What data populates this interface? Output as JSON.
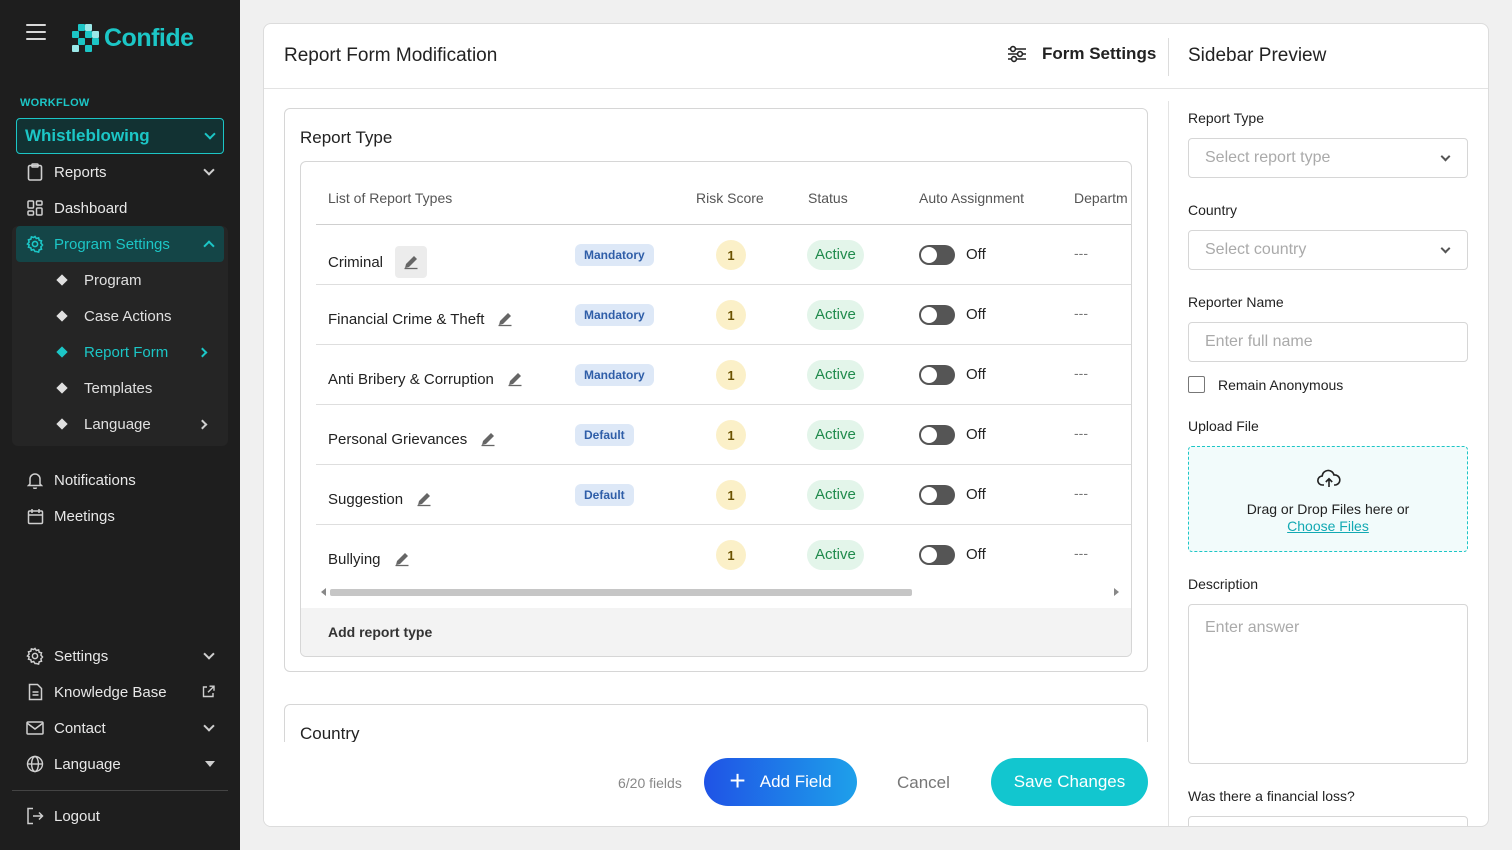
{
  "brand": {
    "name": "Confide",
    "color": "#1cc6c6"
  },
  "sidebar": {
    "section_label": "WORKFLOW",
    "workflow_select": "Whistleblowing",
    "items": [
      {
        "label": "Reports",
        "icon": "clipboard-icon"
      },
      {
        "label": "Dashboard",
        "icon": "dashboard-icon"
      },
      {
        "label": "Program Settings",
        "icon": "gear-icon"
      }
    ],
    "sub_items": [
      {
        "label": "Program"
      },
      {
        "label": "Case Actions"
      },
      {
        "label": "Report Form"
      },
      {
        "label": "Templates"
      },
      {
        "label": "Language"
      }
    ],
    "lower_items": [
      {
        "label": "Notifications",
        "icon": "bell-icon"
      },
      {
        "label": "Meetings",
        "icon": "calendar-icon"
      }
    ],
    "bottom_items": [
      {
        "label": "Settings",
        "icon": "gear-icon"
      },
      {
        "label": "Knowledge Base",
        "icon": "document-icon"
      },
      {
        "label": "Contact",
        "icon": "mail-icon"
      },
      {
        "label": "Language",
        "icon": "globe-icon"
      }
    ],
    "logout": "Logout"
  },
  "main": {
    "title": "Report Form Modification",
    "form_settings": "Form Settings",
    "report_type_section": {
      "title": "Report Type",
      "columns": [
        "List of Report Types",
        "Risk Score",
        "Status",
        "Auto Assignment",
        "Departm"
      ],
      "rows": [
        {
          "name": "Criminal",
          "badge": "Mandatory",
          "risk": "1",
          "status": "Active",
          "auto": "Off",
          "dept": "---"
        },
        {
          "name": "Financial Crime & Theft",
          "badge": "Mandatory",
          "risk": "1",
          "status": "Active",
          "auto": "Off",
          "dept": "---"
        },
        {
          "name": "Anti Bribery & Corruption",
          "badge": "Mandatory",
          "risk": "1",
          "status": "Active",
          "auto": "Off",
          "dept": "---"
        },
        {
          "name": "Personal Grievances",
          "badge": "Default",
          "risk": "1",
          "status": "Active",
          "auto": "Off",
          "dept": "---"
        },
        {
          "name": "Suggestion",
          "badge": "Default",
          "risk": "1",
          "status": "Active",
          "auto": "Off",
          "dept": "---"
        },
        {
          "name": "Bullying",
          "badge": "",
          "risk": "1",
          "status": "Active",
          "auto": "Off",
          "dept": "---"
        }
      ],
      "add_label": "Add report type"
    },
    "country_section": {
      "title": "Country"
    },
    "footer": {
      "field_count": "6/20 fields",
      "add_field": "Add Field",
      "cancel": "Cancel",
      "save": "Save Changes"
    }
  },
  "preview": {
    "title": "Sidebar Preview",
    "report_type_label": "Report Type",
    "report_type_placeholder": "Select report type",
    "country_label": "Country",
    "country_placeholder": "Select country",
    "reporter_label": "Reporter Name",
    "reporter_placeholder": "Enter full name",
    "anonymous_label": "Remain Anonymous",
    "upload_label": "Upload File",
    "upload_text": "Drag or Drop Files here or",
    "upload_link": "Choose Files",
    "description_label": "Description",
    "description_placeholder": "Enter answer",
    "financial_loss_label": "Was there a financial loss?"
  }
}
